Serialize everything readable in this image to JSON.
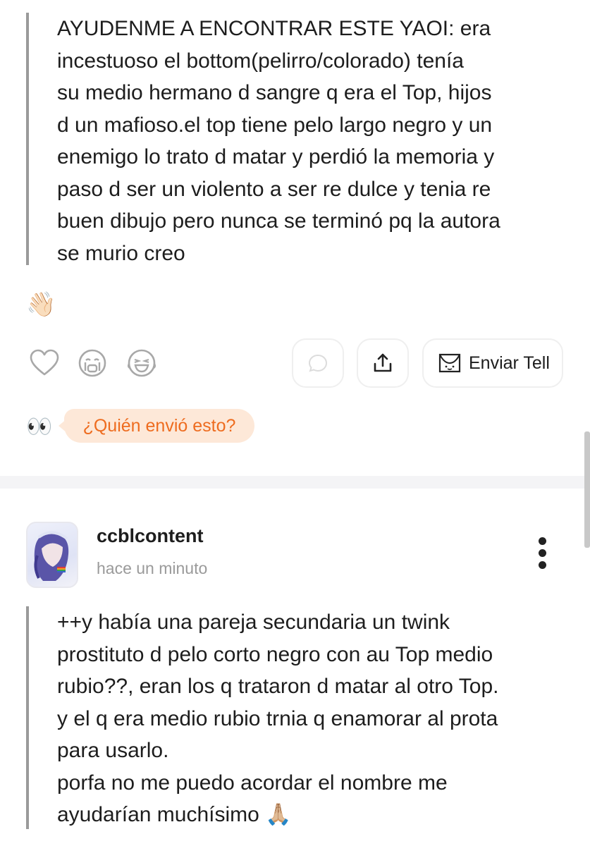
{
  "post1": {
    "text_lines": [
      "AYUDENME A ENCONTRAR ESTE YAOI: era",
      "incestuoso el bottom(pelirro/colorado) tenía",
      "su medio hermano d sangre q era el Top, hijos",
      "d un mafioso.el top tiene pelo largo negro y un",
      "enemigo lo trato d matar y perdió la memoria y",
      "paso d ser un violento a ser re dulce y tenia re",
      "buen dibujo pero nunca se terminó pq la autora",
      "se murio creo"
    ],
    "wave_emoji": "👋🏻",
    "actions": {
      "like_icon": "heart-outline-icon",
      "cry_icon": "crying-face-icon",
      "laugh_icon": "laughing-face-icon",
      "comment_icon": "chat-bubble-icon",
      "share_icon": "share-upload-icon",
      "send_tell_label": "Enviar Tell"
    },
    "eyes_emoji": "👀",
    "who_sent_label": "¿Quién envió esto?"
  },
  "post2": {
    "username": "ccblcontent",
    "timestamp": "hace un minuto",
    "text_lines": [
      "++y había una pareja secundaria un twink",
      "prostituto d pelo corto negro con au Top medio",
      "rubio??, eran los q trataron d matar al otro Top.",
      "y el q era medio rubio trnia q enamorar al prota",
      "para usarlo.",
      "porfa no me puedo acordar el nombre me",
      "ayudarían muchísimo 🙏🏼"
    ]
  },
  "colors": {
    "accent_orange": "#ee6c1f",
    "bubble_bg": "#fde8d8",
    "quote_bar": "#9a9a9a"
  }
}
